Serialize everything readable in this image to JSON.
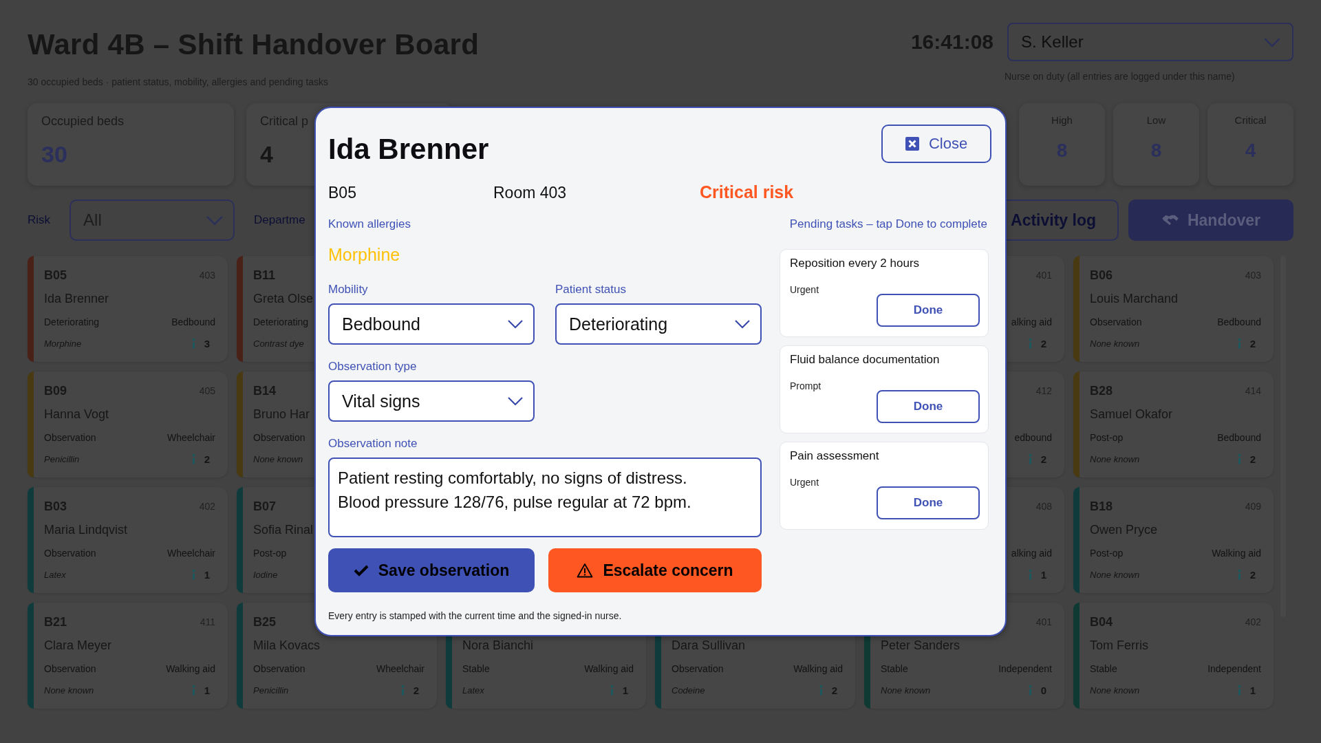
{
  "header": {
    "title": "Ward 4B – Shift Handover Board",
    "subtitle": "30 occupied beds · patient status, mobility, allergies and pending tasks",
    "clock": "16:41:08",
    "nurse": {
      "value": "S. Keller",
      "hint": "Nurse on duty (all entries are logged under this name)"
    }
  },
  "stats_left": [
    {
      "label": "Occupied beds",
      "value": "30",
      "kind": "accent"
    },
    {
      "label": "Critical p",
      "value": "4",
      "kind": "plain"
    }
  ],
  "stats_right": [
    {
      "label": "High",
      "value": "8"
    },
    {
      "label": "Low",
      "value": "8"
    },
    {
      "label": "Critical",
      "value": "4"
    }
  ],
  "filters": {
    "risk_label": "Risk",
    "risk_value": "All",
    "department_label": "Departme"
  },
  "actions": [
    {
      "label": "Activity log",
      "kind": "outline"
    },
    {
      "label": "Handover",
      "kind": "primary"
    }
  ],
  "card_columns": [
    [
      {
        "bed": "B05",
        "room": "403",
        "name": "Ida Brenner",
        "status": "Deteriorating",
        "mobility": "Bedbound",
        "allergy": "Morphine",
        "tasks": "3",
        "color": "#4a2116"
      },
      {
        "bed": "B09",
        "room": "405",
        "name": "Hanna Vogt",
        "status": "Observation",
        "mobility": "Wheelchair",
        "allergy": "Penicillin",
        "tasks": "2",
        "color": "#4a3a12"
      },
      {
        "bed": "B03",
        "room": "402",
        "name": "Maria Lindqvist",
        "status": "Observation",
        "mobility": "Wheelchair",
        "allergy": "Latex",
        "tasks": "1",
        "color": "#0f3b3d"
      },
      {
        "bed": "B21",
        "room": "411",
        "name": "Clara Meyer",
        "status": "Observation",
        "mobility": "Walking aid",
        "allergy": "None known",
        "tasks": "1",
        "color": "#0f3b3d"
      }
    ],
    [
      {
        "bed": "B11",
        "name": "Greta Olse",
        "status": "Deteriorating",
        "allergy": "Contrast dye",
        "color": "#4a2116"
      },
      {
        "bed": "B14",
        "name": "Bruno Har",
        "status": "Observation",
        "allergy": "None known",
        "color": "#4a3a12"
      },
      {
        "bed": "B07",
        "name": "Sofia Rinal",
        "status": "Post-op",
        "allergy": "Iodine",
        "color": "#0f3b3d"
      },
      {
        "bed": "B25",
        "name": "Mila Kovacs",
        "status": "Observation",
        "mobility": "Wheelchair",
        "allergy": "Penicillin",
        "tasks": "2",
        "color": "#0f3b3d"
      }
    ],
    [
      {
        "name": "Nora Bianchi",
        "status": "Stable",
        "mobility": "Walking aid",
        "allergy": "Latex",
        "tasks": "1",
        "color": "#0f3b3d"
      }
    ],
    [
      {
        "name": "Dara Sullivan",
        "status": "Observation",
        "mobility": "Walking aid",
        "allergy": "Codeine",
        "tasks": "2",
        "color": "#0f3b3d"
      }
    ],
    [
      {
        "room": "401",
        "mobility": "alking aid",
        "tasks": "2"
      },
      {
        "room": "412",
        "mobility": "edbound",
        "tasks": "2"
      },
      {
        "room": "408",
        "mobility": "alking aid",
        "tasks": "1"
      },
      {
        "room": "401",
        "name": "Peter Sanders",
        "status": "Stable",
        "mobility": "Independent",
        "allergy": "None known",
        "tasks": "0",
        "color": "#0e3a33"
      }
    ],
    [
      {
        "bed": "B06",
        "room": "403",
        "name": "Louis Marchand",
        "status": "Observation",
        "mobility": "Bedbound",
        "allergy": "None known",
        "tasks": "2",
        "color": "#4a3a12"
      },
      {
        "bed": "B28",
        "room": "414",
        "name": "Samuel Okafor",
        "status": "Post-op",
        "mobility": "Bedbound",
        "allergy": "None known",
        "tasks": "2",
        "color": "#4a3a12"
      },
      {
        "bed": "B18",
        "room": "409",
        "name": "Owen Pryce",
        "status": "Post-op",
        "mobility": "Walking aid",
        "allergy": "None known",
        "tasks": "2",
        "color": "#0f3b3d"
      },
      {
        "bed": "B04",
        "room": "402",
        "name": "Tom Ferris",
        "status": "Stable",
        "mobility": "Independent",
        "allergy": "None known",
        "tasks": "1",
        "color": "#0e3a33"
      }
    ]
  ],
  "dialog": {
    "title": "Ida Brenner",
    "close": "Close",
    "bed": "B05",
    "room": "Room 403",
    "risk": "Critical risk",
    "allergies_label": "Known allergies",
    "allergies": "Morphine",
    "fields": [
      {
        "label": "Mobility",
        "value": "Bedbound"
      },
      {
        "label": "Patient status",
        "value": "Deteriorating"
      },
      {
        "label": "Observation type",
        "value": "Vital signs"
      }
    ],
    "note_label": "Observation note",
    "note": "Patient resting comfortably, no signs of distress.\nBlood pressure 128/76, pulse regular at 72 bpm.",
    "save": "Save observation",
    "escalate": "Escalate concern",
    "footnote": "Every entry is stamped with the current time and the signed-in nurse.",
    "tasks_label": "Pending tasks – tap Done to complete",
    "tasks": [
      {
        "title": "Reposition every 2 hours",
        "priority": "Urgent",
        "action": "Done"
      },
      {
        "title": "Fluid balance documentation",
        "priority": "Prompt",
        "action": "Done"
      },
      {
        "title": "Pain assessment",
        "priority": "Urgent",
        "action": "Done"
      }
    ]
  }
}
